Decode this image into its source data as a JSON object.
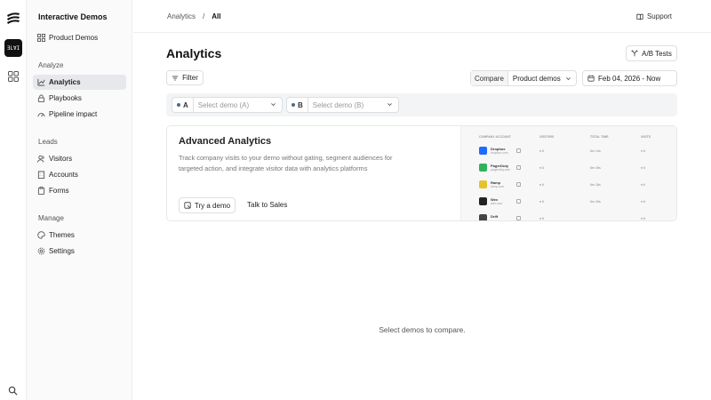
{
  "rail": {
    "avatar_text": "ƎLⱯI"
  },
  "sidebar": {
    "title": "Interactive Demos",
    "top_item": {
      "label": "Product Demos",
      "icon": "grid-icon"
    },
    "sections": [
      {
        "label": "Analyze"
      },
      {
        "label": "Leads"
      },
      {
        "label": "Manage"
      }
    ],
    "items": [
      {
        "label": "Analytics",
        "icon": "bar-chart-icon",
        "active": true
      },
      {
        "label": "Playbooks",
        "icon": "lock-icon"
      },
      {
        "label": "Pipeline impact",
        "icon": "gauge-icon"
      },
      {
        "label": "Visitors",
        "icon": "users-icon"
      },
      {
        "label": "Accounts",
        "icon": "building-icon"
      },
      {
        "label": "Forms",
        "icon": "clipboard-icon"
      },
      {
        "label": "Themes",
        "icon": "palette-icon"
      },
      {
        "label": "Settings",
        "icon": "gear-icon"
      }
    ]
  },
  "topbar": {
    "breadcrumb": {
      "parent": "Analytics",
      "sep": "/",
      "current": "All"
    },
    "support_label": "Support"
  },
  "main": {
    "title": "Analytics",
    "ab_tests_label": "A/B Tests",
    "filter_label": "Filter",
    "compare_label": "Compare",
    "compare_value": "Product demos",
    "date_range": "Feb 04, 2026 - Now",
    "select_a": {
      "tag": "A",
      "placeholder": "Select demo (A)"
    },
    "select_b": {
      "tag": "B",
      "placeholder": "Select demo (B)"
    },
    "promo": {
      "title": "Advanced Analytics",
      "description": "Track company visits to your demo without gating, segment audiences for targeted action, and integrate visitor data with analytics platforms",
      "try_label": "Try a demo",
      "sales_label": "Talk to Sales",
      "preview": {
        "headers": [
          "COMPANY ACCOUNT",
          "VISITORS",
          "TOTAL TIME",
          "VISITS"
        ],
        "rows": [
          {
            "name": "Dropbox",
            "domain": "dropbox.com",
            "visitors": "● 6",
            "time": "6m 14s",
            "visits": "● 6",
            "color": "#1f6bff"
          },
          {
            "name": "PagerDuty",
            "domain": "pagerduty.com",
            "visitors": "● 6",
            "time": "6m 49s",
            "visits": "● 6",
            "color": "#2fb35a"
          },
          {
            "name": "Ramp",
            "domain": "ramp.com",
            "visitors": "● 6",
            "time": "6m 18s",
            "visits": "● 6",
            "color": "#e6c32a"
          },
          {
            "name": "Wex",
            "domain": "wex.com",
            "visitors": "● 6",
            "time": "6m 49s",
            "visits": "● 6",
            "color": "#222222"
          },
          {
            "name": "Drift",
            "domain": "",
            "visitors": "● 6",
            "time": "",
            "visits": "● 6",
            "color": "#444444"
          }
        ]
      }
    },
    "empty_message": "Select demos to compare."
  }
}
